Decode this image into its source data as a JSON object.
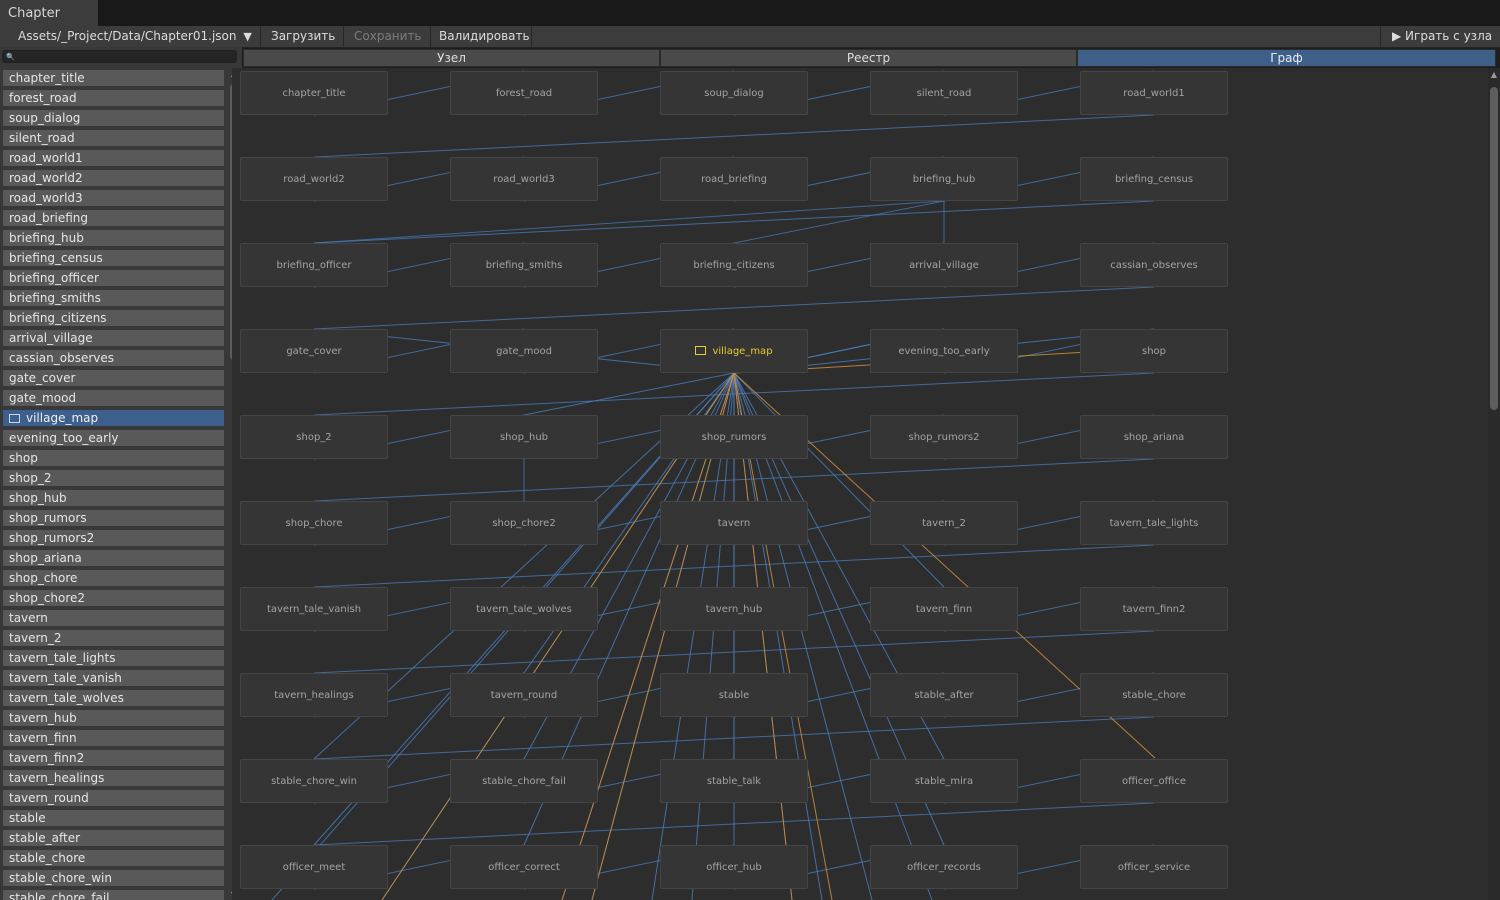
{
  "window": {
    "title": "Chapter Editor"
  },
  "toolbar": {
    "file_path": "Assets/_Project/Data/Chapter01.json",
    "dropdown_arrow": "▼",
    "load": "Загрузить",
    "save": "Сохранить",
    "validate": "Валидировать",
    "play_from_node": "▶ Играть с узла"
  },
  "sidebar": {
    "search_icon": "🔍",
    "items": [
      "chapter_title",
      "forest_road",
      "soup_dialog",
      "silent_road",
      "road_world1",
      "road_world2",
      "road_world3",
      "road_briefing",
      "briefing_hub",
      "briefing_census",
      "briefing_officer",
      "briefing_smiths",
      "briefing_citizens",
      "arrival_village",
      "cassian_observes",
      "gate_cover",
      "gate_mood",
      "village_map",
      "evening_too_early",
      "shop",
      "shop_2",
      "shop_hub",
      "shop_rumors",
      "shop_rumors2",
      "shop_ariana",
      "shop_chore",
      "shop_chore2",
      "tavern",
      "tavern_2",
      "tavern_tale_lights",
      "tavern_tale_vanish",
      "tavern_tale_wolves",
      "tavern_hub",
      "tavern_finn",
      "tavern_finn2",
      "tavern_healings",
      "tavern_round",
      "stable",
      "stable_after",
      "stable_chore",
      "stable_chore_win",
      "stable_chore_fail"
    ],
    "selected": "village_map",
    "selected_icon": "map-icon"
  },
  "tabs": [
    "Узел",
    "Реестр",
    "Граф"
  ],
  "active_tab": "Граф",
  "graph": {
    "nodes": [
      "chapter_title",
      "forest_road",
      "soup_dialog",
      "silent_road",
      "road_world1",
      "road_world2",
      "road_world3",
      "road_briefing",
      "briefing_hub",
      "briefing_census",
      "briefing_officer",
      "briefing_smiths",
      "briefing_citizens",
      "arrival_village",
      "cassian_observes",
      "gate_cover",
      "gate_mood",
      "village_map",
      "evening_too_early",
      "shop",
      "shop_2",
      "shop_hub",
      "shop_rumors",
      "shop_rumors2",
      "shop_ariana",
      "shop_chore",
      "shop_chore2",
      "tavern",
      "tavern_2",
      "tavern_tale_lights",
      "tavern_tale_vanish",
      "tavern_tale_wolves",
      "tavern_hub",
      "tavern_finn",
      "tavern_finn2",
      "tavern_healings",
      "tavern_round",
      "stable",
      "stable_after",
      "stable_chore",
      "stable_chore_win",
      "stable_chore_fail",
      "stable_talk",
      "stable_mira",
      "officer_office",
      "officer_meet",
      "officer_correct",
      "officer_hub",
      "officer_records",
      "officer_service"
    ],
    "selected_node": "village_map",
    "colors": {
      "edge": "#4a7fc1",
      "edge_highlight": "#c88a3a",
      "selected_text": "#e6cc2c",
      "active_tab": "#3e5f87"
    }
  }
}
